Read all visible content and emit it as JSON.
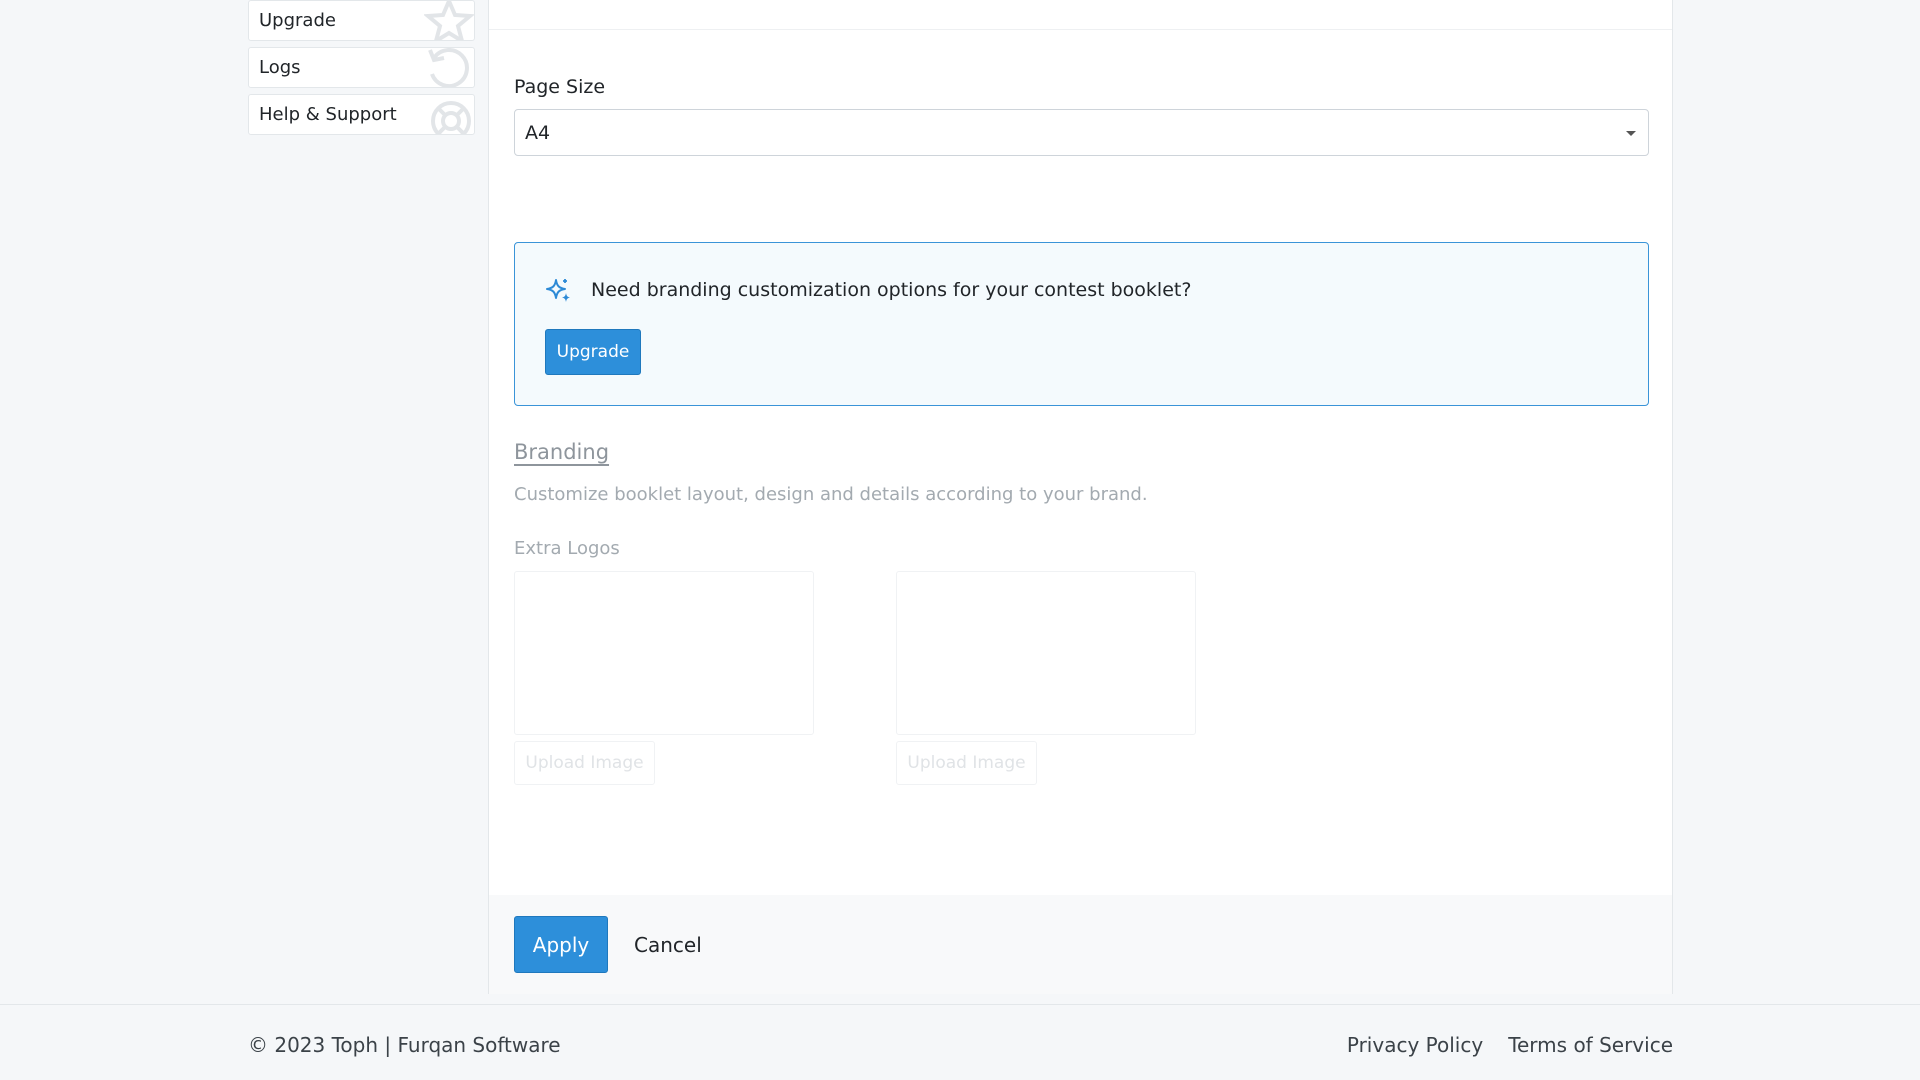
{
  "sidebar": {
    "items": [
      {
        "label": "Upgrade",
        "icon": "star-icon"
      },
      {
        "label": "Logs",
        "icon": "history-icon"
      },
      {
        "label": "Help & Support",
        "icon": "life-ring-icon"
      }
    ]
  },
  "form": {
    "page_size_label": "Page Size",
    "page_size_value": "A4"
  },
  "promo": {
    "message": "Need branding customization options for your contest booklet?",
    "button_label": "Upgrade",
    "icon": "sparkles-icon"
  },
  "branding": {
    "title": "Branding",
    "description": "Customize booklet layout, design and details according to your brand.",
    "extra_logos_label": "Extra Logos",
    "upload_label_1": "Upload Image",
    "upload_label_2": "Upload Image"
  },
  "actions": {
    "apply_label": "Apply",
    "cancel_label": "Cancel"
  },
  "footer": {
    "copyright": "© 2023 Toph | Furqan Software",
    "privacy": "Privacy Policy",
    "terms": "Terms of Service"
  },
  "colors": {
    "accent": "#2d8fda",
    "promo_bg": "#f4fafd"
  }
}
